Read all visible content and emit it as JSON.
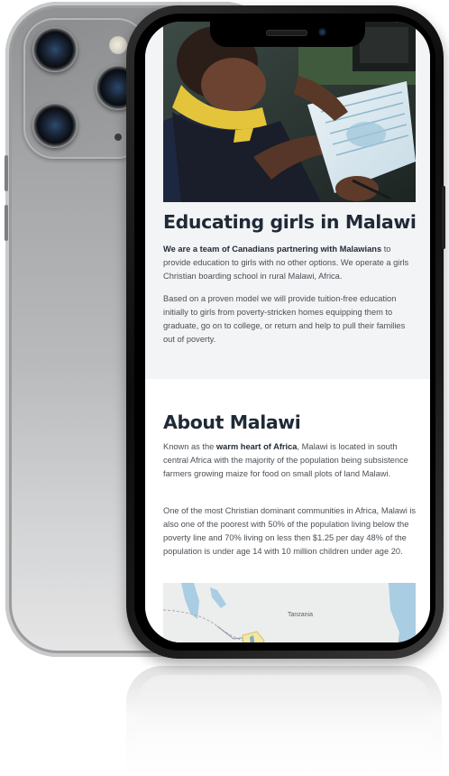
{
  "education": {
    "title": "Educating girls in Malawi",
    "p1_bold": "We are a team of Canadians partnering with Malawians",
    "p1_rest": " to provide education to girls with no other options. We operate a girls Christian boarding school in rural Malawi, Africa.",
    "p2": "Based on a proven model we will provide tuition-free education initially to girls from poverty-stricken homes equipping them to graduate, go on to college, or return and help to pull their families out of poverty."
  },
  "about": {
    "title": "About Malawi",
    "p1_start": "Known as the ",
    "p1_bold": "warm heart of Africa",
    "p1_rest": ", Malawi is located in south central Africa with the majority of the population being subsistence farmers growing maize for food on small plots of land Malawi.",
    "p2": "One of the most Christian dominant communities in Africa, Malawi is also one of the poorest with 50% of the population living below the poverty line and 70% living on less then $1.25 per day 48% of the population is under age 14 with 10 million children under age 20."
  },
  "map": {
    "label": "Tanzania"
  },
  "colors": {
    "heading": "#1f2a36",
    "body_text": "#4a4f55",
    "section_bg": "#f3f4f6",
    "phone_frame": "#0c0c0c",
    "phone_back": "#a4a6a8"
  },
  "icons": {
    "camera_lenses": "camera-lens-icon",
    "flash": "flash-icon",
    "front_camera": "front-camera-icon"
  }
}
